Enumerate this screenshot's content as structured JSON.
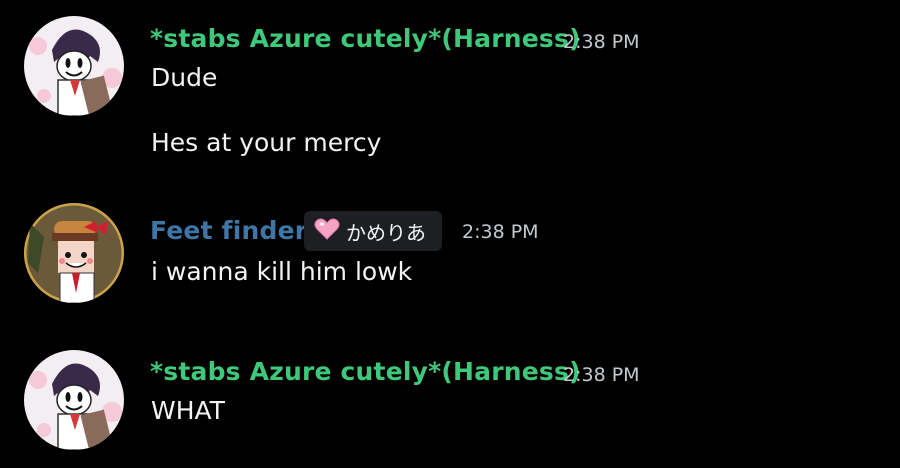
{
  "messages": [
    {
      "author": "*stabs Azure cutely*(Harness)",
      "author_color": "#3ec87a",
      "time": "2:38 PM",
      "lines": [
        "Dude",
        "Hes at your mercy"
      ]
    },
    {
      "author": "Feet finder",
      "author_color": "#3f76a6",
      "tag_icon": "pink-heart-icon",
      "tag_text": "かめりあ",
      "time": "2:38 PM",
      "lines": [
        "i wanna kill him lowk"
      ]
    },
    {
      "author": "*stabs Azure cutely*(Harness)",
      "author_color": "#3ec87a",
      "time": "2:38 PM",
      "lines": [
        "WHAT"
      ]
    }
  ],
  "colors": {
    "background": "#000000",
    "text": "#f2f3f5",
    "timestamp": "#c4c9ce",
    "tag_background": "#1e1f22"
  }
}
